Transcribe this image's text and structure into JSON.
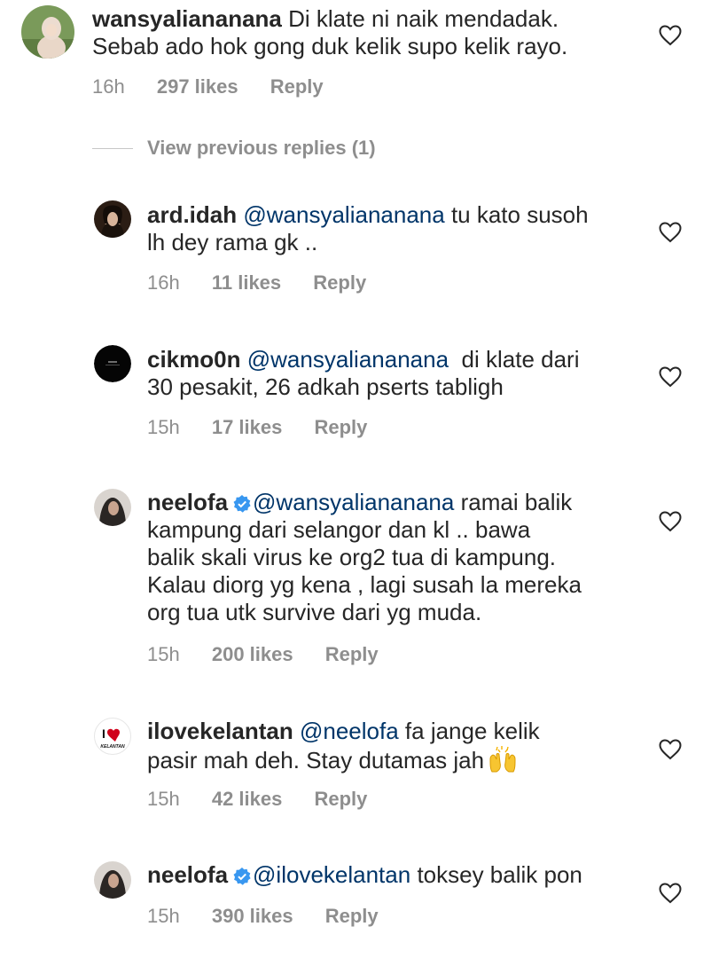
{
  "comments": [
    {
      "username": "wansyaliananana",
      "mention": "",
      "text": "Di klate ni naik mendadak.",
      "text2": "Sebab ado hok gong duk kelik supo kelik rayo.",
      "time": "16h",
      "likes": "297 likes",
      "reply": "Reply",
      "verified": false
    },
    {
      "username": "ard.idah",
      "mention": "@wansyaliananana",
      "text": "tu kato susoh",
      "text2": "lh dey rama gk ..",
      "time": "16h",
      "likes": "11 likes",
      "reply": "Reply",
      "verified": false
    },
    {
      "username": "cikmo0n",
      "mention": "@wansyaliananana",
      "text": " di klate dari",
      "text2": "30 pesakit, 26 adkah pserts tabligh",
      "time": "15h",
      "likes": "17 likes",
      "reply": "Reply",
      "verified": false
    },
    {
      "username": "neelofa",
      "mention": "@wansyaliananana",
      "text": "ramai balik",
      "text2": "kampung dari selangor dan kl .. bawa",
      "text3": "balik skali virus ke org2 tua di kampung.",
      "text4": "Kalau diorg yg kena , lagi susah la mereka",
      "text5": "org tua utk survive dari yg muda.",
      "time": "15h",
      "likes": "200 likes",
      "reply": "Reply",
      "verified": true
    },
    {
      "username": "ilovekelantan",
      "mention": "@neelofa",
      "text": "fa jange kelik",
      "text2": "pasir mah deh. Stay dutamas jah",
      "time": "15h",
      "likes": "42 likes",
      "reply": "Reply",
      "verified": false
    },
    {
      "username": "neelofa",
      "mention": "@ilovekelantan",
      "text": "toksey balik pon",
      "time": "15h",
      "likes": "390 likes",
      "reply": "Reply",
      "verified": true
    }
  ],
  "view_previous_replies": "View previous replies (1)",
  "avatar_labels": {
    "ilovekelantan_top": "I",
    "ilovekelantan_bottom": "KELANTAN"
  },
  "colors": {
    "mention": "#003569",
    "meta": "#8e8e8e",
    "verified": "#3897f0"
  }
}
